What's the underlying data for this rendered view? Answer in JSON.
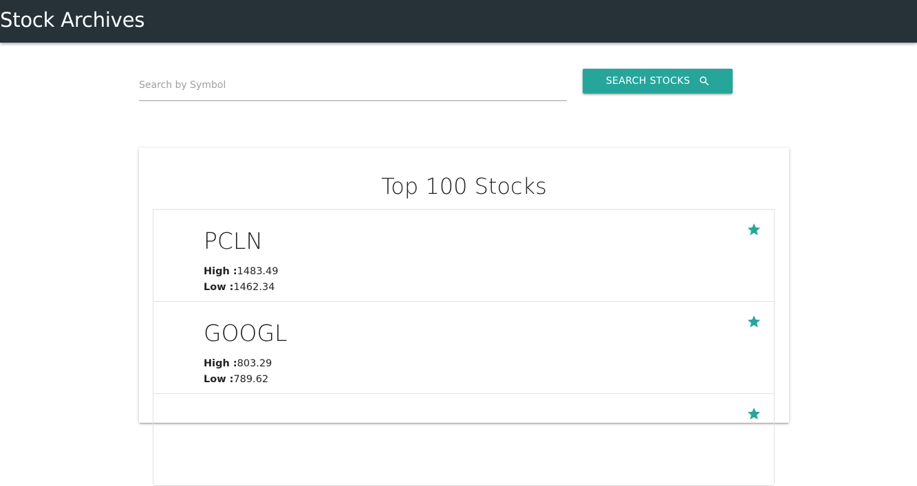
{
  "app": {
    "title": "Stock Archives"
  },
  "search": {
    "placeholder": "Search by Symbol",
    "value": "",
    "button_label": "SEARCH STOCKS",
    "button_icon": "search-icon"
  },
  "card": {
    "title": "Top 100 Stocks"
  },
  "stocks": [
    {
      "symbol": "PCLN",
      "high_label": "High :",
      "high": "1483.49",
      "low_label": "Low :",
      "low": "1462.34",
      "icon": "star-icon"
    },
    {
      "symbol": "GOOGL",
      "high_label": "High :",
      "high": "803.29",
      "low_label": "Low :",
      "low": "789.62",
      "icon": "star-icon"
    }
  ],
  "colors": {
    "navbar": "#263238",
    "accent": "#26a69a",
    "text": "#222222",
    "placeholder": "#9e9e9e"
  }
}
